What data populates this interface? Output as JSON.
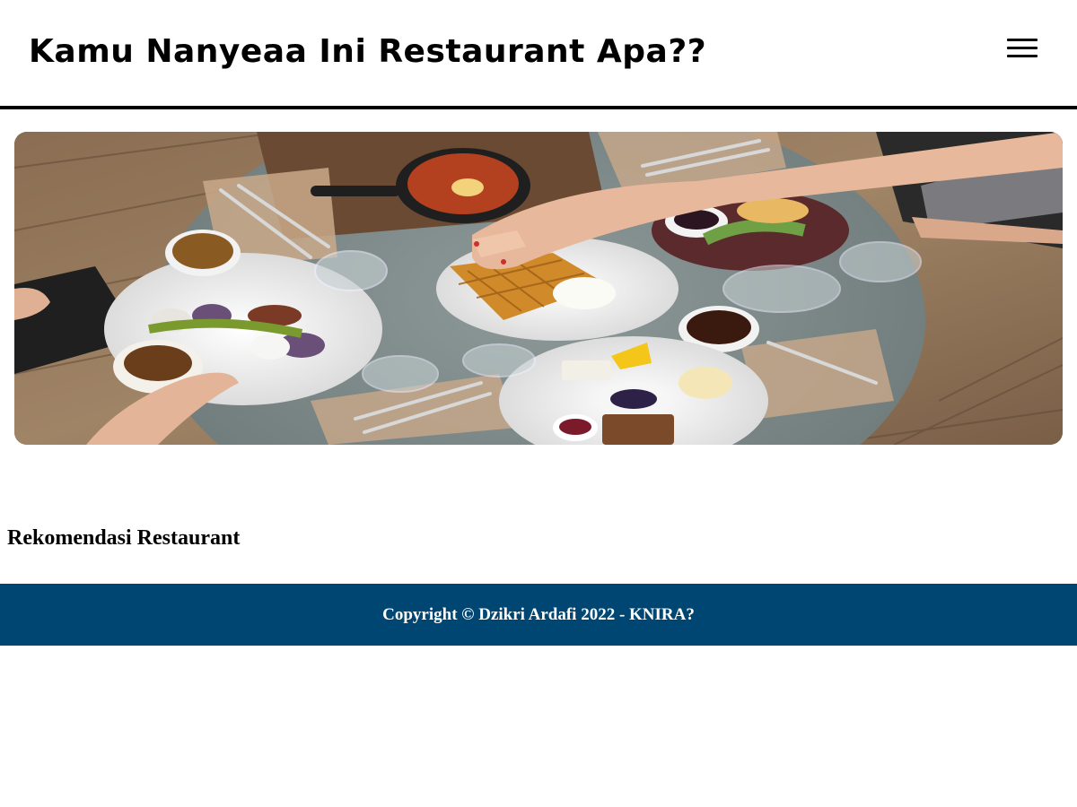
{
  "header": {
    "title": "Kamu Nanyeaa Ini Restaurant Apa??",
    "menu_icon": "hamburger-menu-icon"
  },
  "hero": {
    "image": "restaurant-table-food-photo"
  },
  "main": {
    "section_title": "Rekomendasi Restaurant"
  },
  "footer": {
    "copyright": "Copyright © Dzikri Ardafi 2022 - KNIRA?"
  },
  "colors": {
    "header_border": "#000000",
    "footer_bg": "#004672",
    "footer_text": "#ffffff"
  }
}
